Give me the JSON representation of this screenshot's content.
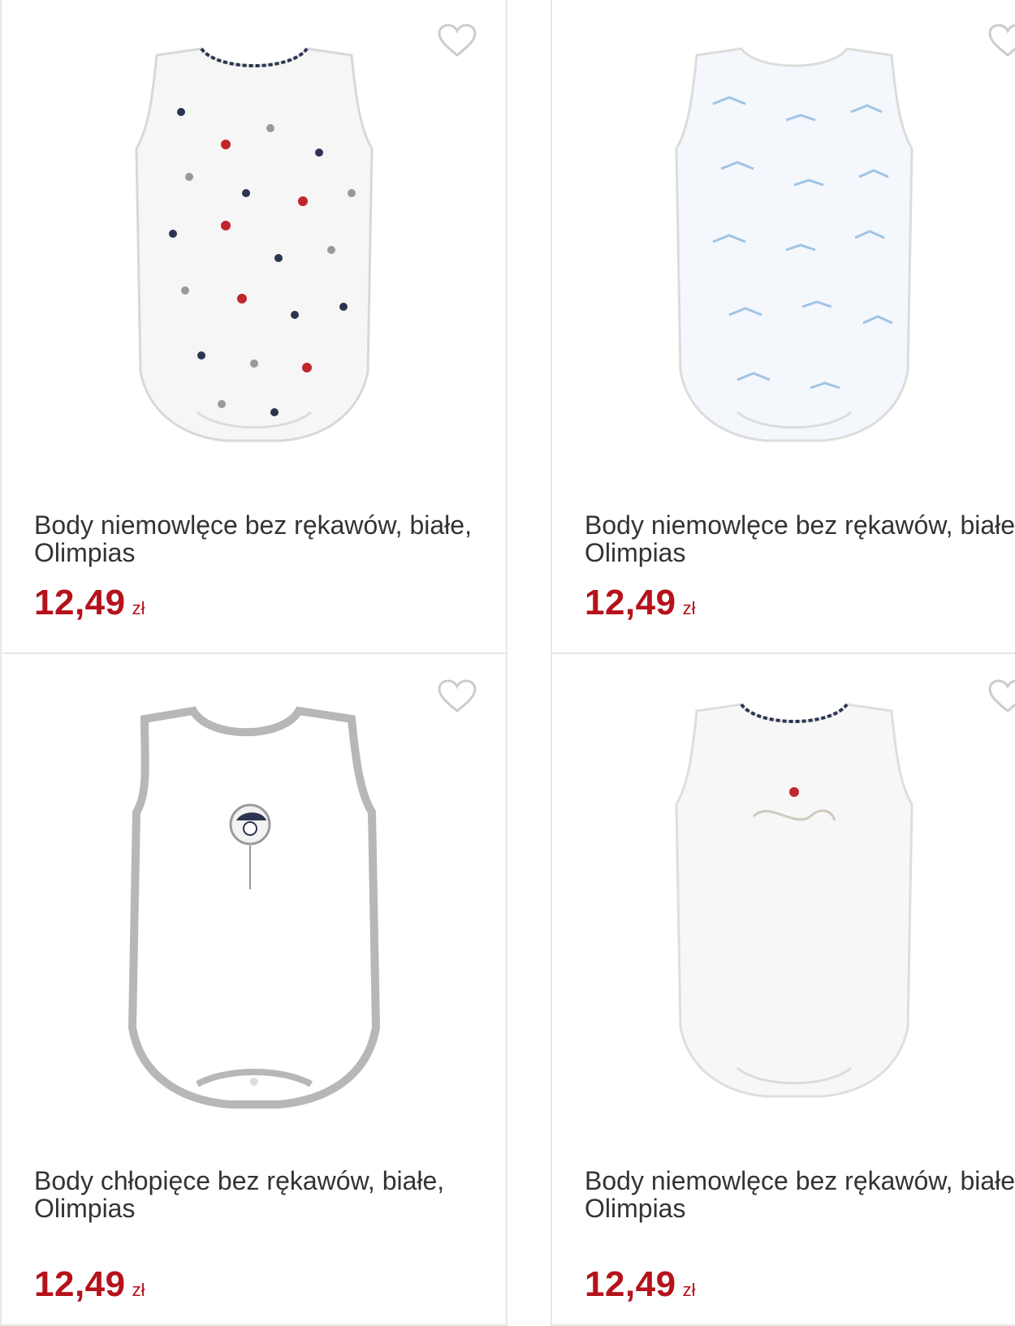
{
  "products": [
    {
      "title": "Body niemowlęce bez rękawów, białe, Olimpias",
      "price": "12,49",
      "currency": "zł",
      "favorite_icon": "heart-outline-icon",
      "pattern": "dots-red-navy-grey"
    },
    {
      "title": "Body niemowlęce bez rękawów, białe, Olimpias",
      "price": "12,49",
      "currency": "zł",
      "favorite_icon": "heart-outline-icon",
      "pattern": "light-blue-print"
    },
    {
      "title": "Body chłopięce bez rękawów, białe, Olimpias",
      "price": "12,49",
      "currency": "zł",
      "favorite_icon": "heart-outline-icon",
      "pattern": "grey-trim-badge"
    },
    {
      "title": "Body niemowlęce bez rękawów, białe, Olimpias",
      "price": "12,49",
      "currency": "zł",
      "favorite_icon": "heart-outline-icon",
      "pattern": "plain-scalloped-collar"
    }
  ],
  "colors": {
    "price": "#b5121b",
    "title": "#333333",
    "border": "#e8e8e8",
    "heart": "#cccccc"
  }
}
